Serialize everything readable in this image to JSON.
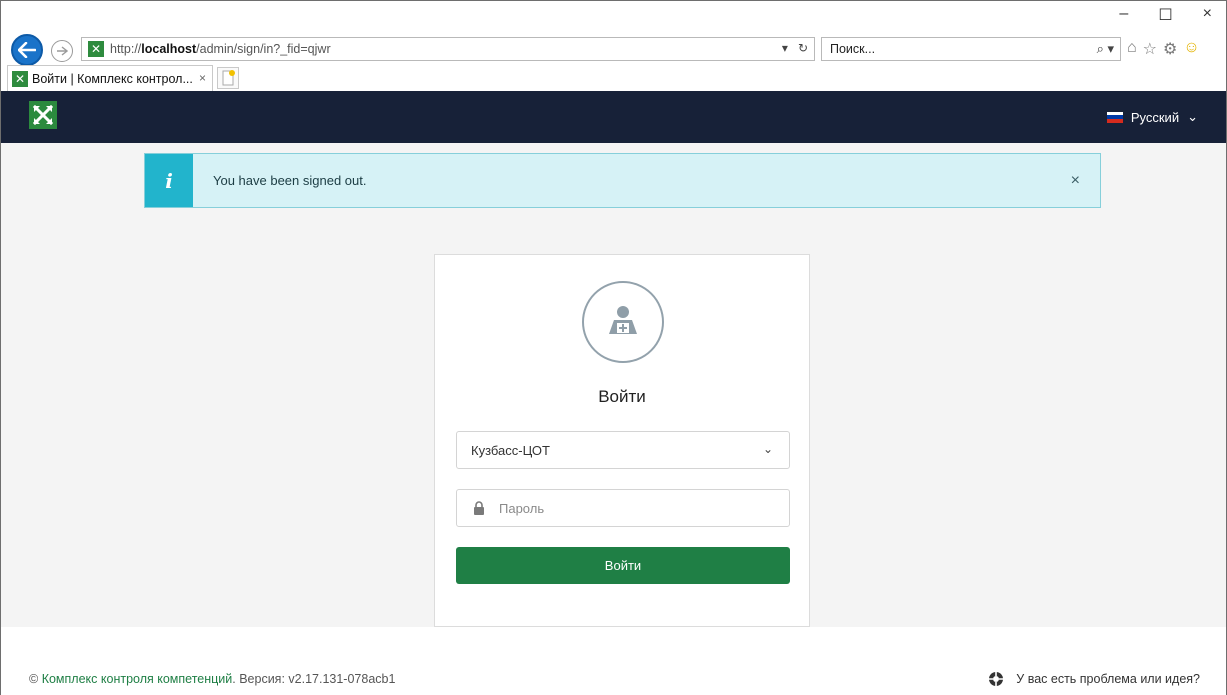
{
  "browser": {
    "url_prefix": "http://",
    "url_host": "localhost",
    "url_path": "/admin/sign/in?_fid=qjwr",
    "url_dropdown": "▾",
    "refresh": "↻",
    "search_placeholder": "Поиск...",
    "search_icon": "⌕ ▾",
    "tab_title": "Войти | Комплекс контрол...",
    "tab_close": "×",
    "minimize": "–",
    "maximize": "☐",
    "close": "×",
    "icons": [
      "home-icon",
      "star-icon",
      "gear-icon",
      "smiley-icon"
    ]
  },
  "header": {
    "language": "Русский",
    "language_chevron": "⌄",
    "flag_colors": [
      "#ffffff",
      "#0039a6",
      "#d52b1e"
    ],
    "bg_color": "#172138"
  },
  "alert": {
    "icon": "i",
    "message": "You have been signed out.",
    "close": "×"
  },
  "login": {
    "title": "Войти",
    "organization": "Кузбасс-ЦОТ",
    "organization_chevron": "⌄",
    "password_placeholder": "Пароль",
    "submit_label": "Войти",
    "accent_color": "#1f7f45"
  },
  "footer": {
    "copyright": "©",
    "product_link": "Комплекс контроля компетенций",
    "version_text": ". Версия: v2.17.131-078acb1",
    "help_text": "У вас есть проблема или идея?"
  }
}
